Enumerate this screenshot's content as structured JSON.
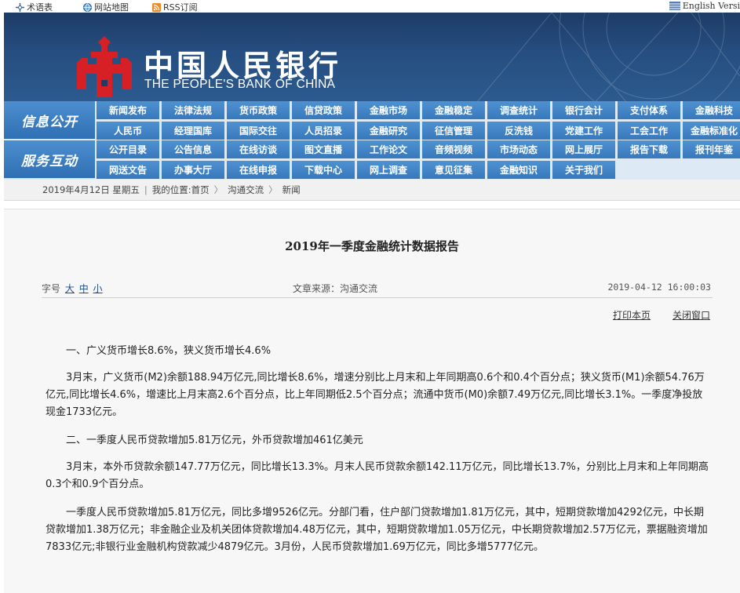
{
  "topbar": {
    "glossary": "术语表",
    "sitemap": "网站地图",
    "rss": "RSS订阅",
    "english": "English Versi"
  },
  "banner": {
    "name_cn": "中国人民银行",
    "name_en": "THE PEOPLE'S BANK OF CHINA"
  },
  "nav": {
    "row1_label": "信息公开",
    "row2_label": "服务互动",
    "row1_items": [
      [
        "新闻发布",
        "法律法规",
        "货币政策",
        "信贷政策",
        "金融市场",
        "金融稳定",
        "调查统计",
        "银行会计",
        "支付体系",
        "金融科技"
      ],
      [
        "人民币",
        "经理国库",
        "国际交往",
        "人员招录",
        "金融研究",
        "征信管理",
        "反洗钱",
        "党建工作",
        "工会工作",
        "金融标准化"
      ]
    ],
    "row2_items": [
      [
        "公开目录",
        "公告信息",
        "在线访谈",
        "图文直播",
        "工作论文",
        "音频视频",
        "市场动态",
        "网上展厅",
        "报告下载",
        "报刊年鉴"
      ],
      [
        "网送文告",
        "办事大厅",
        "在线申报",
        "下载中心",
        "网上调查",
        "意见征集",
        "金融知识",
        "关于我们"
      ]
    ]
  },
  "breadcrumb": {
    "date": "2019年4月12日 星期五",
    "location_label": "我的位置:",
    "items": [
      "首页",
      "沟通交流",
      "新闻"
    ]
  },
  "article": {
    "title": "2019年一季度金融统计数据报告",
    "font_size_label": "字号",
    "font_large": "大",
    "font_medium": "中",
    "font_small": "小",
    "source": "文章来源：沟通交流",
    "datetime": "2019-04-12 16:00:03",
    "print": "打印本页",
    "close": "关闭窗口",
    "paragraphs": [
      "一、广义货币增长8.6%，狭义货币增长4.6%",
      "3月末，广义货币(M2)余额188.94万亿元,同比增长8.6%，增速分别比上月末和上年同期高0.6个和0.4个百分点；狭义货币(M1)余额54.76万亿元,同比增长4.6%，增速比上月末高2.6个百分点，比上年同期低2.5个百分点；流通中货币(M0)余额7.49万亿元,同比增长3.1%。一季度净投放现金1733亿元。",
      "二、一季度人民币贷款增加5.81万亿元，外币贷款增加461亿美元",
      "3月末，本外币贷款余额147.77万亿元，同比增长13.3%。月末人民币贷款余额142.11万亿元，同比增长13.7%，分别比上月末和上年同期高0.3个和0.9个百分点。",
      "一季度人民币贷款增加5.81万亿元，同比多增9526亿元。分部门看，住户部门贷款增加1.81万亿元，其中，短期贷款增加4292亿元，中长期贷款增加1.38万亿元；非金融企业及机关团体贷款增加4.48万亿元，其中，短期贷款增加1.05万亿元，中长期贷款增加2.57万亿元，票据融资增加7833亿元;非银行业金融机构贷款减少4879亿元。3月份，人民币贷款增加1.69万亿元，同比多增5777亿元。"
    ]
  }
}
